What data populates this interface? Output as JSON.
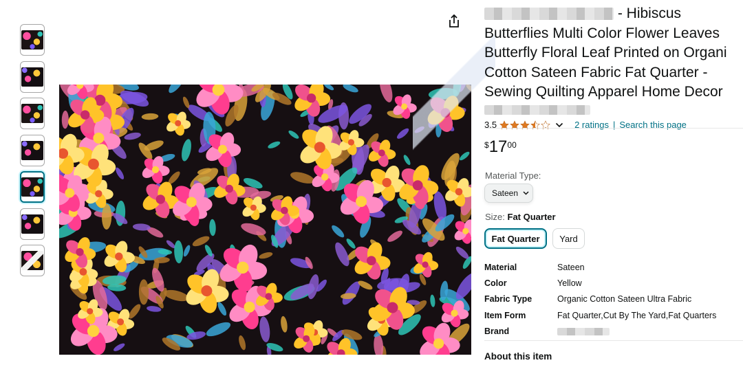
{
  "product": {
    "title_lines": [
      " - Hibiscus",
      "Butterflies Multi Color Flower Leaves",
      "Butterfly Floral Leaf Printed on Organi",
      "Cotton Sateen Fabric Fat Quarter -",
      "Sewing Quilting Apparel Home Decor"
    ],
    "rating_value": "3.5",
    "ratings_link": "2 ratings",
    "search_link": "Search this page",
    "ratings_separator": "|",
    "price": {
      "currency": "$",
      "whole": "17",
      "fraction": "00"
    }
  },
  "material": {
    "label": "Material Type:",
    "selected": "Sateen"
  },
  "size": {
    "label": "Size: ",
    "selected_value": "Fat Quarter",
    "options": [
      "Fat Quarter",
      "Yard"
    ]
  },
  "specs": [
    {
      "key": "Material",
      "value": "Sateen"
    },
    {
      "key": "Color",
      "value": "Yellow"
    },
    {
      "key": "Fabric Type",
      "value": "Organic Cotton Sateen Ultra Fabric"
    },
    {
      "key": "Item Form",
      "value": "Fat Quarter,Cut By The Yard,Fat Quarters"
    },
    {
      "key": "Brand",
      "value": ""
    }
  ],
  "about_heading": "About this item",
  "icons": {
    "share": "share-icon",
    "star_full": "star-full-icon",
    "star_half": "star-half-icon",
    "star_empty": "star-empty-icon",
    "chevron": "chevron-down-icon"
  },
  "colors": {
    "accent": "#007185",
    "star": "#de7921"
  }
}
